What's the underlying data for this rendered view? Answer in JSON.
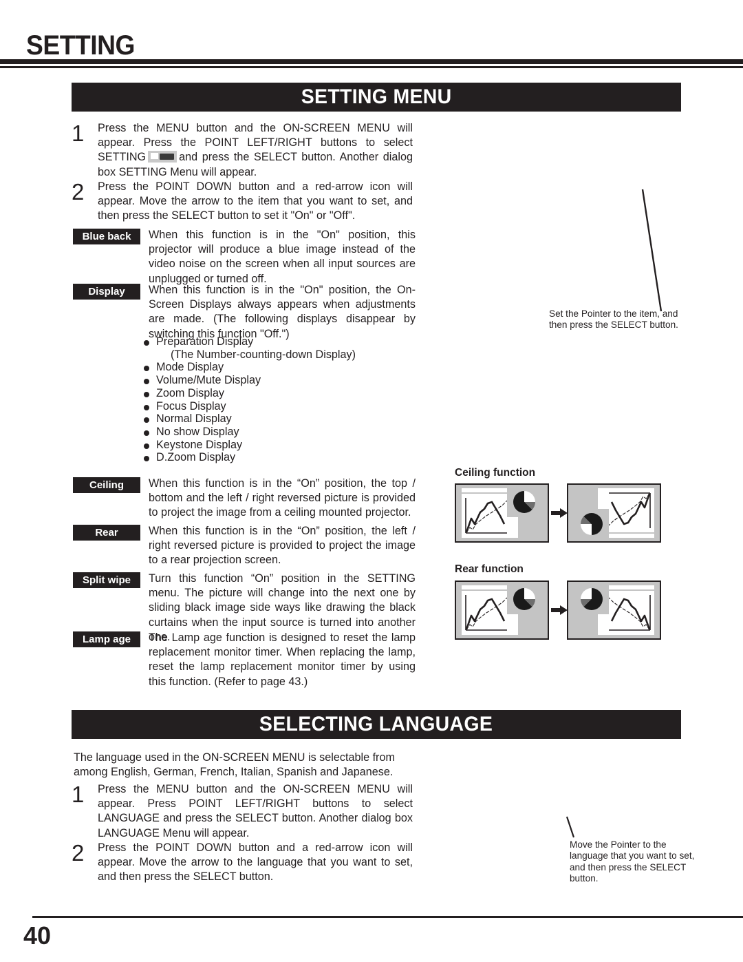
{
  "page": {
    "header_title": "SETTING",
    "page_number": "40"
  },
  "sections": {
    "setting_menu": {
      "banner": "SETTING MENU",
      "steps": [
        {
          "number": "1",
          "text_before_icon": "Press the MENU button and the ON-SCREEN MENU will appear.  Press the POINT LEFT/RIGHT buttons to select SETTING",
          "icon_name": "setting-menu-icon",
          "text_after_icon": "and press the SELECT button.  Another dialog box SETTING Menu will appear."
        },
        {
          "number": "2",
          "text": "Press the POINT DOWN button and a red-arrow icon will appear.  Move the arrow to the item that you want to set, and then press the SELECT button to set it \"On\" or \"Off\"."
        }
      ],
      "functions": [
        {
          "tag": "Blue back",
          "text": "When this function is in the \"On\" position, this projector will produce a blue image instead of the video noise on the screen when all input sources are unplugged or turned off."
        },
        {
          "tag": "Display",
          "text": "When this function is in the \"On\" position, the On-Screen Displays always appears when adjustments are made.  (The following displays disappear by switching this function \"Off.\")"
        },
        {
          "tag": "Ceiling",
          "text": "When this function is in the “On” position, the top / bottom and the left / right reversed picture is provided to project the image from a ceiling mounted projector."
        },
        {
          "tag": "Rear",
          "text": "When this function is in the “On” position, the left / right reversed picture is provided to project the image to a rear projection screen."
        },
        {
          "tag": "Split wipe",
          "text": "Turn this function “On” position in the SETTING menu. The picture will change into the next one by sliding black image side ways like drawing the black curtains when the input source is turned into another one."
        },
        {
          "tag": "Lamp age",
          "text": "The Lamp age function is designed to reset the lamp replacement monitor timer.  When replacing the lamp, reset the lamp replacement monitor timer by using this function.  (Refer to page 43.)"
        }
      ],
      "display_bullets": [
        "Preparation Display",
        "Mode Display",
        "Volume/Mute Display",
        "Zoom Display",
        "Focus Display",
        "Normal Display",
        "No show Display",
        "Keystone Display",
        "D.Zoom Display"
      ],
      "display_bullet_subnote": "(The Number-counting-down Display)"
    },
    "selecting_language": {
      "banner": "SELECTING LANGUAGE",
      "intro": "The language used in the ON-SCREEN MENU is selectable from among English, German, French, Italian, Spanish and Japanese.",
      "steps": [
        {
          "number": "1",
          "text": "Press the MENU button and the ON-SCREEN MENU will appear.  Press POINT LEFT/RIGHT buttons to select LANGUAGE  and press the SELECT button.  Another dialog box LANGUAGE Menu will appear."
        },
        {
          "number": "2",
          "text": "Press the POINT DOWN button and a red-arrow icon will appear.  Move the arrow to the language that you want to set, and then press the SELECT button."
        }
      ]
    }
  },
  "callouts": {
    "pointer_setting": "Set the Pointer to the item, and then press the SELECT button.",
    "pointer_language": "Move the Pointer to the language that you want to set, and then press the SELECT button."
  },
  "figures": {
    "ceiling": {
      "caption": "Ceiling function",
      "left_label": "normal-projection-image",
      "right_label": "ceiling-rotated-image",
      "arrow": "right-arrow-icon"
    },
    "rear": {
      "caption": "Rear function",
      "left_label": "normal-projection-image",
      "right_label": "rear-mirrored-image",
      "arrow": "right-arrow-icon"
    }
  },
  "colors": {
    "ink": "#231f20",
    "panel_grey": "#c4c4c4",
    "pie_dark": "#1a1a1a",
    "pie_mid": "#6e6e6e"
  }
}
